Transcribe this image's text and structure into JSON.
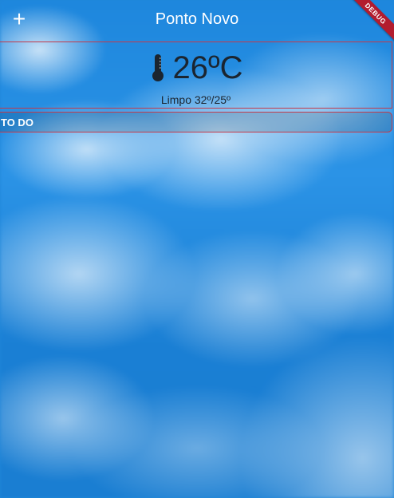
{
  "app_bar": {
    "title": "Ponto Novo",
    "add_label": "+"
  },
  "debug_banner": "DEBUG",
  "weather": {
    "temperature": "26ºC",
    "condition": "Limpo 32º/25º",
    "icon": "thermometer-icon"
  },
  "todo": {
    "label": "TO DO"
  },
  "colors": {
    "sky": "#1f86d9",
    "text_dark": "#1b2530",
    "outline": "#c33a4a",
    "ribbon": "#b21c2e"
  }
}
